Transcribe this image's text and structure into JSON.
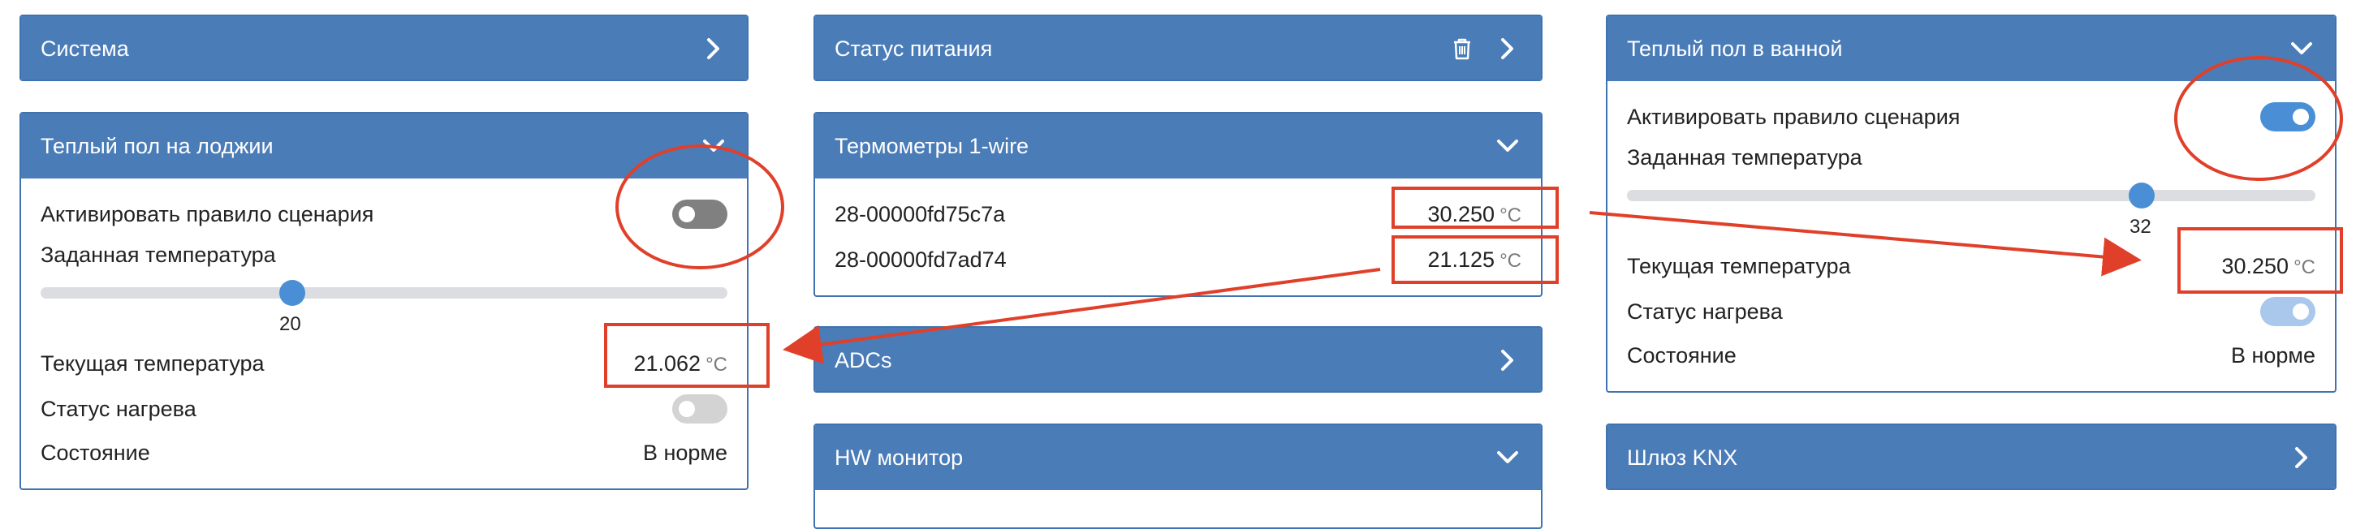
{
  "left": {
    "sistema": {
      "title": "Система"
    },
    "loggia": {
      "title": "Теплый пол на лоджии",
      "activate_label": "Активировать правило сценария",
      "activate_on": false,
      "setpoint_label": "Заданная температура",
      "setpoint_value": "20",
      "current_label": "Текущая температура",
      "current_value": "21.062",
      "unit": "°C",
      "heating_label": "Статус нагрева",
      "state_label": "Состояние",
      "state_value": "В норме"
    }
  },
  "middle": {
    "power": {
      "title": "Статус питания"
    },
    "onewire": {
      "title": "Термометры 1-wire",
      "sensors": [
        {
          "id": "28-00000fd75c7a",
          "value": "30.250",
          "unit": "°C"
        },
        {
          "id": "28-00000fd7ad74",
          "value": "21.125",
          "unit": "°C"
        }
      ]
    },
    "adcs": {
      "title": "ADCs"
    },
    "hw": {
      "title": "HW монитор"
    }
  },
  "right": {
    "bathroom": {
      "title": "Теплый пол в ванной",
      "activate_label": "Активировать правило сценария",
      "activate_on": true,
      "setpoint_label": "Заданная температура",
      "setpoint_value": "32",
      "current_label": "Текущая температура",
      "current_value": "30.250",
      "unit": "°C",
      "heating_label": "Статус нагрева",
      "state_label": "Состояние",
      "state_value": "В норме"
    },
    "knx": {
      "title": "Шлюз KNX"
    }
  },
  "colors": {
    "header": "#4a7cb8",
    "toggle_on": "#4a8fd6",
    "toggle_off": "#808080",
    "annotation": "#e0402a"
  }
}
